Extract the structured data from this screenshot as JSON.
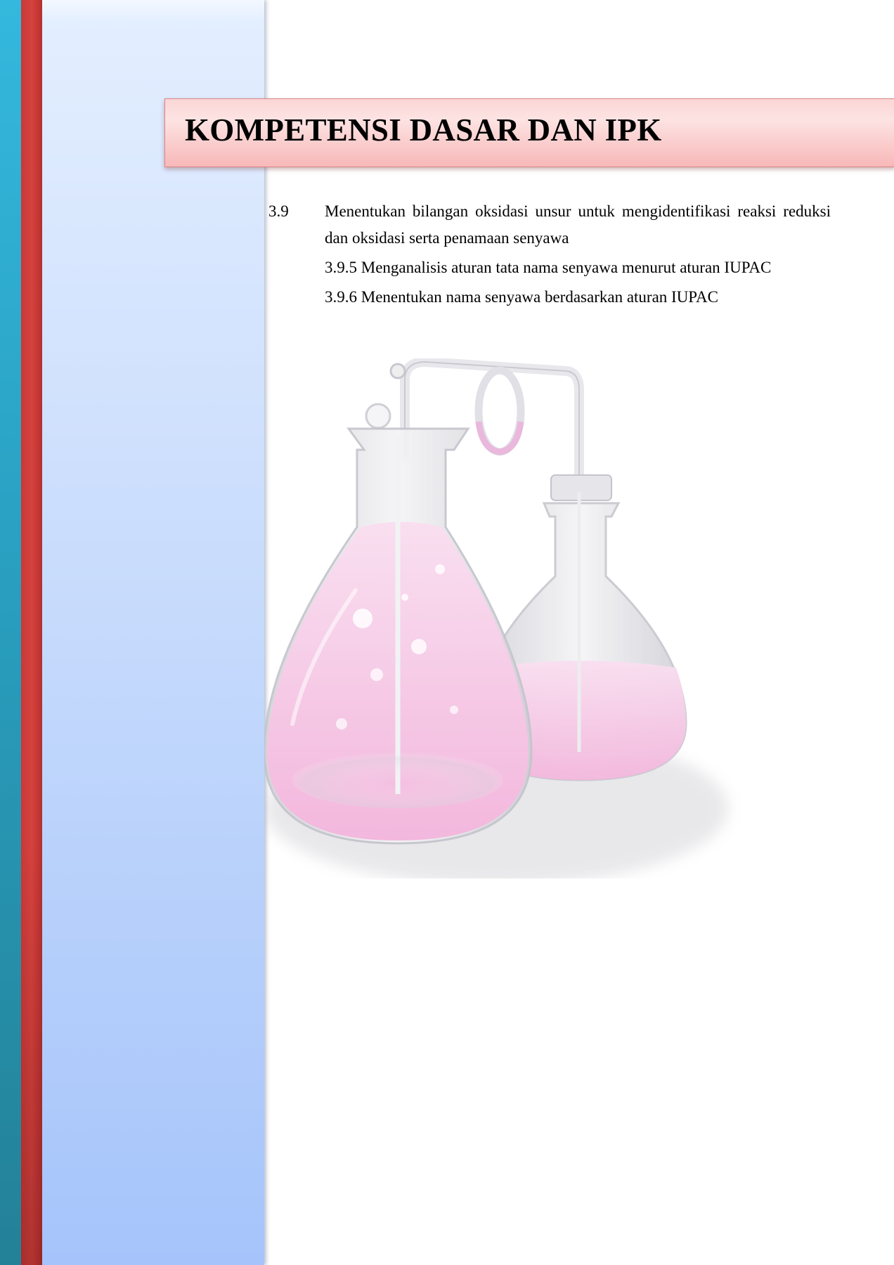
{
  "heading": {
    "title": "KOMPETENSI DASAR DAN IPK"
  },
  "kompetensi_dasar": {
    "code": "3.9",
    "text": "Menentukan bilangan oksidasi unsur untuk mengidentifikasi reaksi reduksi dan oksidasi serta penamaan senyawa"
  },
  "ipk": [
    {
      "text": "3.9.5 Menganalisis aturan tata nama senyawa menurut aturan IUPAC"
    },
    {
      "text": "3.9.6 Menentukan nama senyawa berdasarkan aturan IUPAC"
    }
  ],
  "illustration": {
    "icon": "chemistry-flasks-icon",
    "liquid_color": "#f5c6e4",
    "glass_color": "#e6e6ea"
  },
  "colors": {
    "teal_strip": "#2aa2c4",
    "red_strip": "#d6423e",
    "side_panel": "#cfe0fd",
    "banner": "#f8b8b8"
  }
}
